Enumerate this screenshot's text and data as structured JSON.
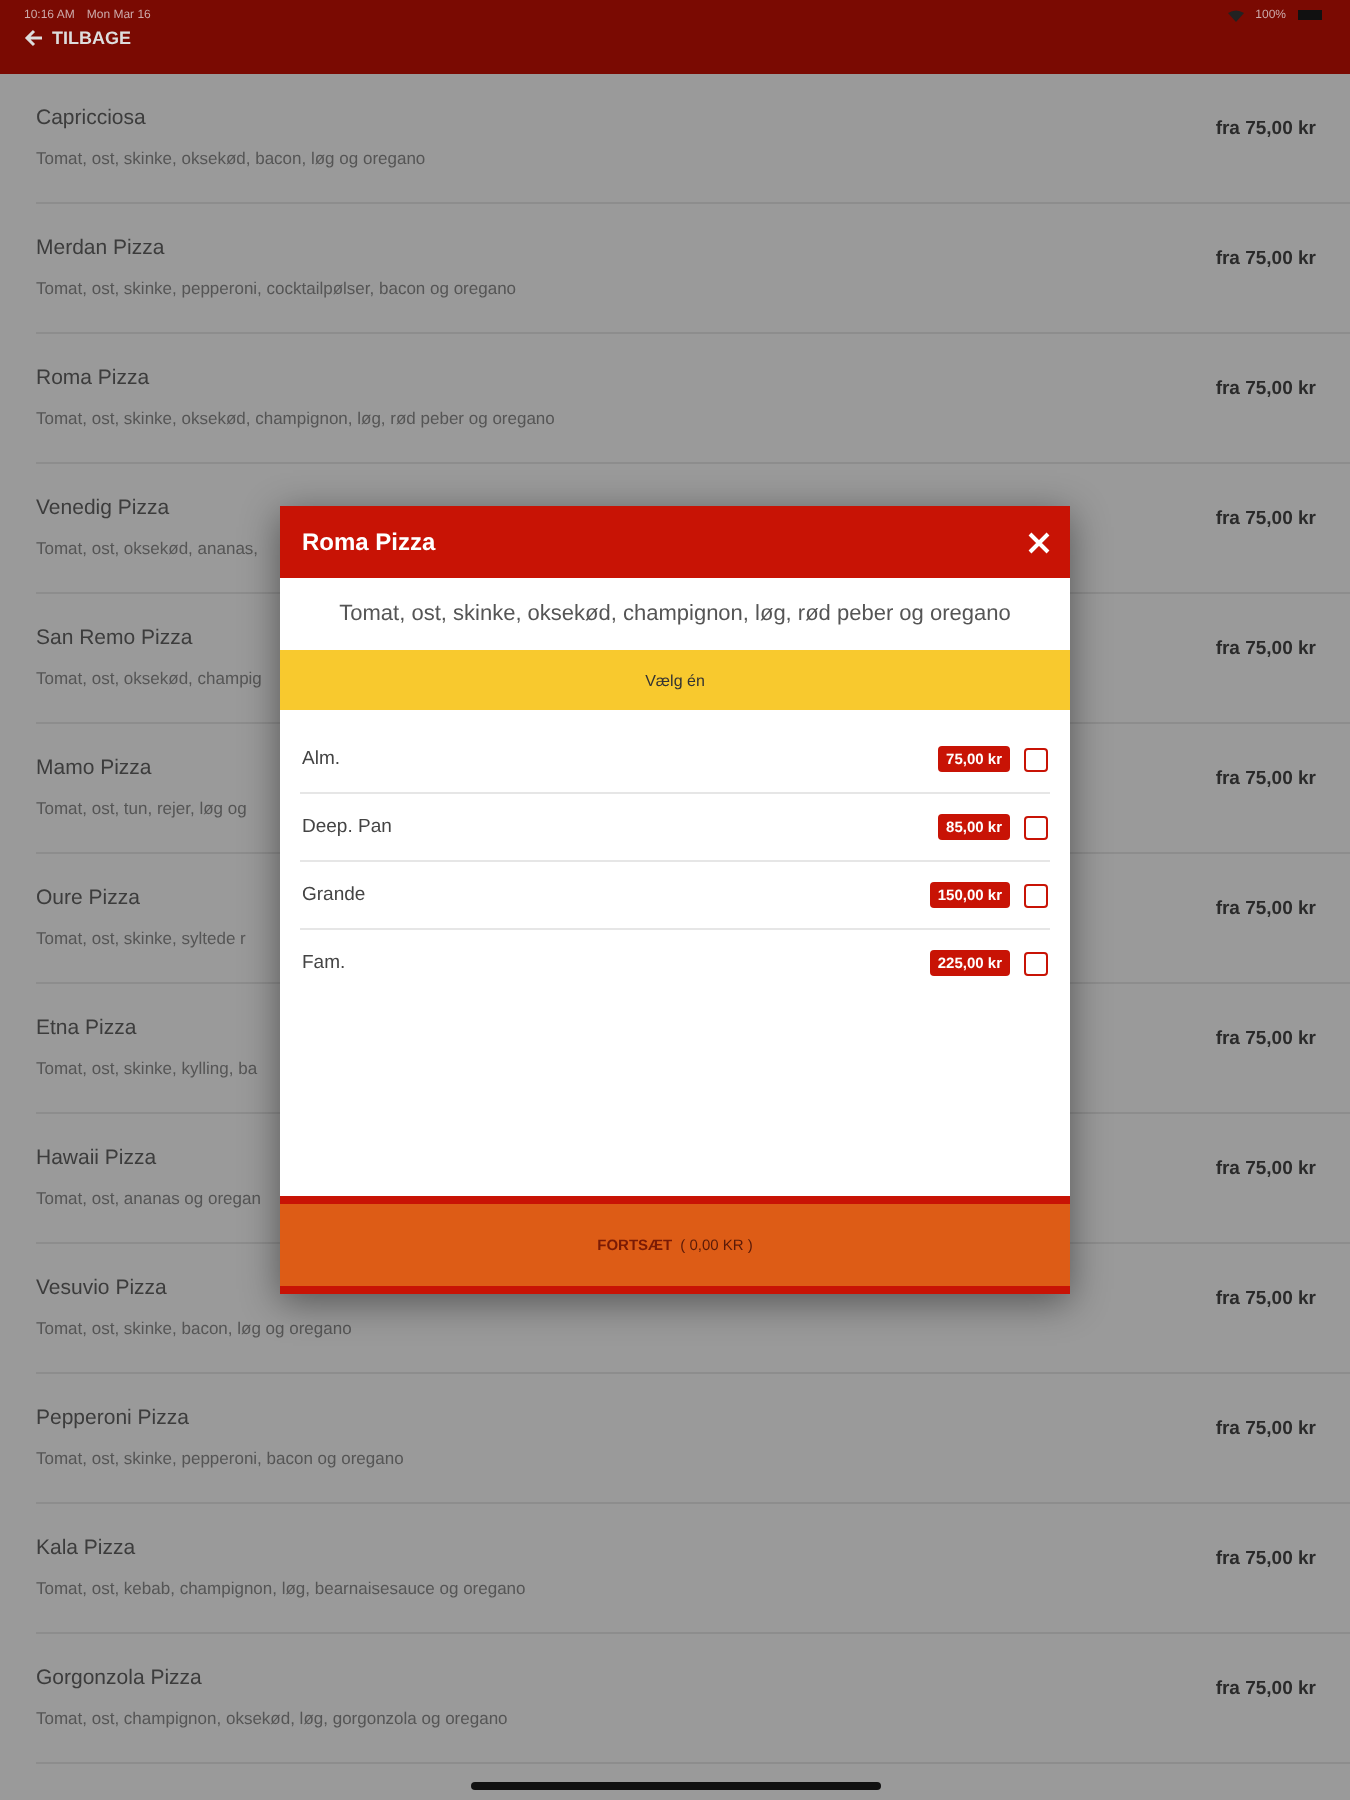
{
  "status_bar": {
    "time": "10:16 AM",
    "date": "Mon Mar 16",
    "battery": "100%"
  },
  "header": {
    "back_label": "TILBAGE"
  },
  "menu_items": [
    {
      "name": "Capricciosa",
      "description": "Tomat, ost, skinke, oksekød, bacon, løg og oregano",
      "price": "fra 75,00 kr"
    },
    {
      "name": "Merdan Pizza",
      "description": "Tomat, ost, skinke, pepperoni, cocktailpølser, bacon og oregano",
      "price": "fra 75,00 kr"
    },
    {
      "name": "Roma Pizza",
      "description": "Tomat, ost, skinke, oksekød, champignon, løg, rød peber og oregano",
      "price": "fra 75,00 kr"
    },
    {
      "name": "Venedig Pizza",
      "description": "Tomat, ost, oksekød, ananas,",
      "price": "fra 75,00 kr"
    },
    {
      "name": "San Remo Pizza",
      "description": "Tomat, ost, oksekød, champig",
      "price": "fra 75,00 kr"
    },
    {
      "name": "Mamo Pizza",
      "description": "Tomat, ost, tun, rejer, løg og",
      "price": "fra 75,00 kr"
    },
    {
      "name": "Oure Pizza",
      "description": "Tomat, ost, skinke, syltede r",
      "price": "fra 75,00 kr"
    },
    {
      "name": "Etna Pizza",
      "description": "Tomat, ost, skinke, kylling, ba",
      "price": "fra 75,00 kr"
    },
    {
      "name": "Hawaii Pizza",
      "description": "Tomat, ost, ananas og oregan",
      "price": "fra 75,00 kr"
    },
    {
      "name": "Vesuvio Pizza",
      "description": "Tomat, ost, skinke, bacon, løg og oregano",
      "price": "fra 75,00 kr"
    },
    {
      "name": "Pepperoni Pizza",
      "description": "Tomat, ost, skinke, pepperoni, bacon og oregano",
      "price": "fra 75,00 kr"
    },
    {
      "name": "Kala Pizza",
      "description": "Tomat, ost, kebab, champignon, løg, bearnaisesauce og oregano",
      "price": "fra 75,00 kr"
    },
    {
      "name": "Gorgonzola Pizza",
      "description": "Tomat, ost, champignon, oksekød, løg, gorgonzola og oregano",
      "price": "fra 75,00 kr"
    }
  ],
  "dialog": {
    "title": "Roma Pizza",
    "description": "Tomat, ost, skinke, oksekød, champignon, løg, rød peber og oregano",
    "prompt": "Vælg én",
    "options": [
      {
        "label": "Alm.",
        "price": "75,00 kr",
        "checked": false
      },
      {
        "label": "Deep. Pan",
        "price": "85,00 kr",
        "checked": false
      },
      {
        "label": "Grande",
        "price": "150,00 kr",
        "checked": false
      },
      {
        "label": "Fam.",
        "price": "225,00 kr",
        "checked": false
      }
    ],
    "continue_button": {
      "label": "FORTSÆT",
      "total": "( 0,00 KR )"
    }
  }
}
